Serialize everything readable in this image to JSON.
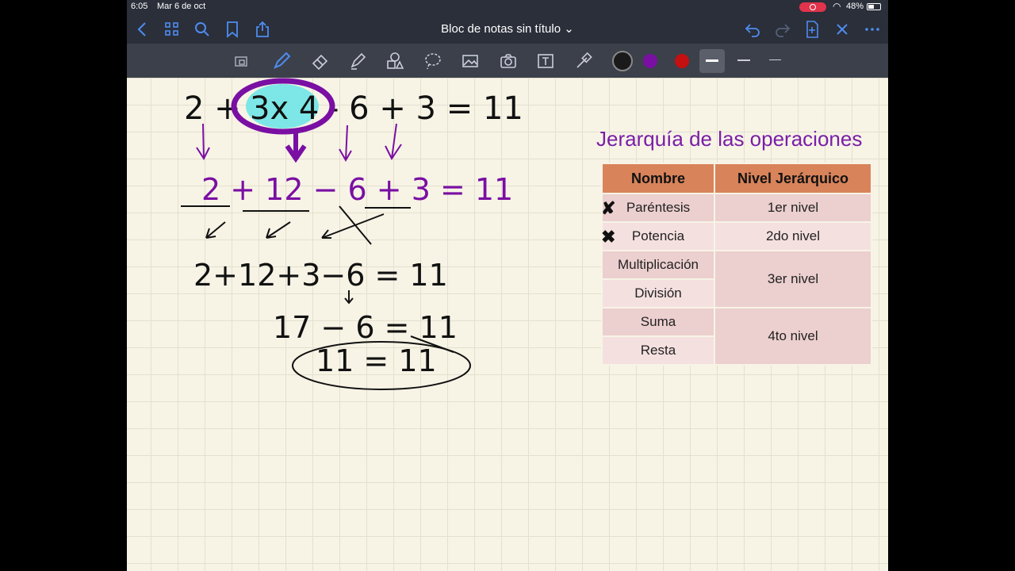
{
  "status_bar": {
    "time": "6:05",
    "date": "Mar 6 de oct",
    "battery": "48%"
  },
  "nav": {
    "title": "Bloc de notas sin título ⌄"
  },
  "toolbar": {
    "colors": {
      "black": "#1a1a1a",
      "purple": "#7a0fa3",
      "red": "#c41010"
    }
  },
  "board": {
    "heading": "Jerarquía de las operaciones",
    "table": {
      "headers": [
        "Nombre",
        "Nivel Jerárquico"
      ],
      "rows": [
        {
          "name": "Paréntesis",
          "level": "1er nivel",
          "marked": true
        },
        {
          "name": "Potencia",
          "level": "2do nivel",
          "marked": true
        },
        {
          "name": "Multiplicación",
          "level": "3er nivel"
        },
        {
          "name": "División"
        },
        {
          "name": "Suma",
          "level": "4to nivel"
        },
        {
          "name": "Resta"
        }
      ]
    },
    "handwriting": {
      "line1": {
        "a": "2 +",
        "b": "3x 4",
        "c": "- 6 + 3 = 11"
      },
      "line2": "2 + 12 − 6 + 3 = 11",
      "line3": "2+12+3−6 = 11",
      "line4": "17 − 6 = 11",
      "line5": "11 = 11"
    }
  }
}
